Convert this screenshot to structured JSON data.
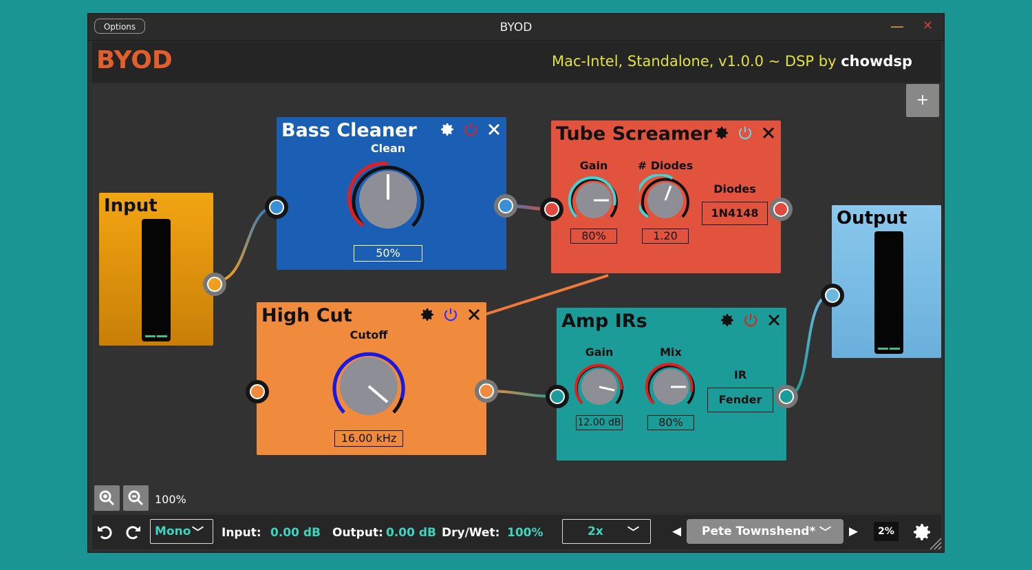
{
  "window": {
    "title": "BYOD",
    "options_label": "Options",
    "minimize_icon": "minimize-icon",
    "close_icon": "close-icon"
  },
  "header": {
    "brand": "BYOD",
    "version_text": "Mac-Intel, Standalone, v1.0.0 ~ DSP by",
    "author": "chowdsp"
  },
  "canvas": {
    "add_label": "+"
  },
  "modules": {
    "input": {
      "title": "Input"
    },
    "bass_cleaner": {
      "title": "Bass Cleaner",
      "knob_label": "Clean",
      "value": "50%",
      "level": 0.5,
      "power_color": "#e02020"
    },
    "tube_screamer": {
      "title": "Tube Screamer",
      "gain_label": "Gain",
      "gain_value": "80%",
      "gain_level": 0.8,
      "diodes_label": "# Diodes",
      "diodes_value": "1.20",
      "diode_type_label": "Diodes",
      "diode_type_value": "1N4148",
      "power_color": "#6ad8e8"
    },
    "high_cut": {
      "title": "High Cut",
      "knob_label": "Cutoff",
      "value": "16.00 kHz",
      "power_color": "#2a2aff"
    },
    "amp_irs": {
      "title": "Amp IRs",
      "gain_label": "Gain",
      "gain_value": "12.00 dB",
      "mix_label": "Mix",
      "mix_value": "80%",
      "ir_label": "IR",
      "ir_value": "Fender",
      "power_color": "#e02020"
    },
    "output": {
      "title": "Output"
    }
  },
  "zoom": {
    "level": "100%",
    "zoom_in_icon": "zoom-in-icon",
    "zoom_out_icon": "zoom-out-icon"
  },
  "bottom": {
    "mode": "Mono",
    "input_label": "Input:",
    "input_value": "0.00 dB",
    "output_label": "Output:",
    "output_value": "0.00 dB",
    "drywet_label": "Dry/Wet:",
    "drywet_value": "100%",
    "oversampling": "2x",
    "preset": "Pete Townshend*",
    "cpu": "2%"
  },
  "colors": {
    "accent_text": "#3fd4c0",
    "brand": "#e15f2d",
    "version": "#e2e240",
    "bass_cleaner_bg": "#1a5fb4",
    "tube_screamer_bg": "#e1533c",
    "high_cut_bg": "#f08a3c",
    "amp_irs_bg": "#1c9c98",
    "input_bg": "#efa012",
    "output_bg": "#86c4e8"
  }
}
